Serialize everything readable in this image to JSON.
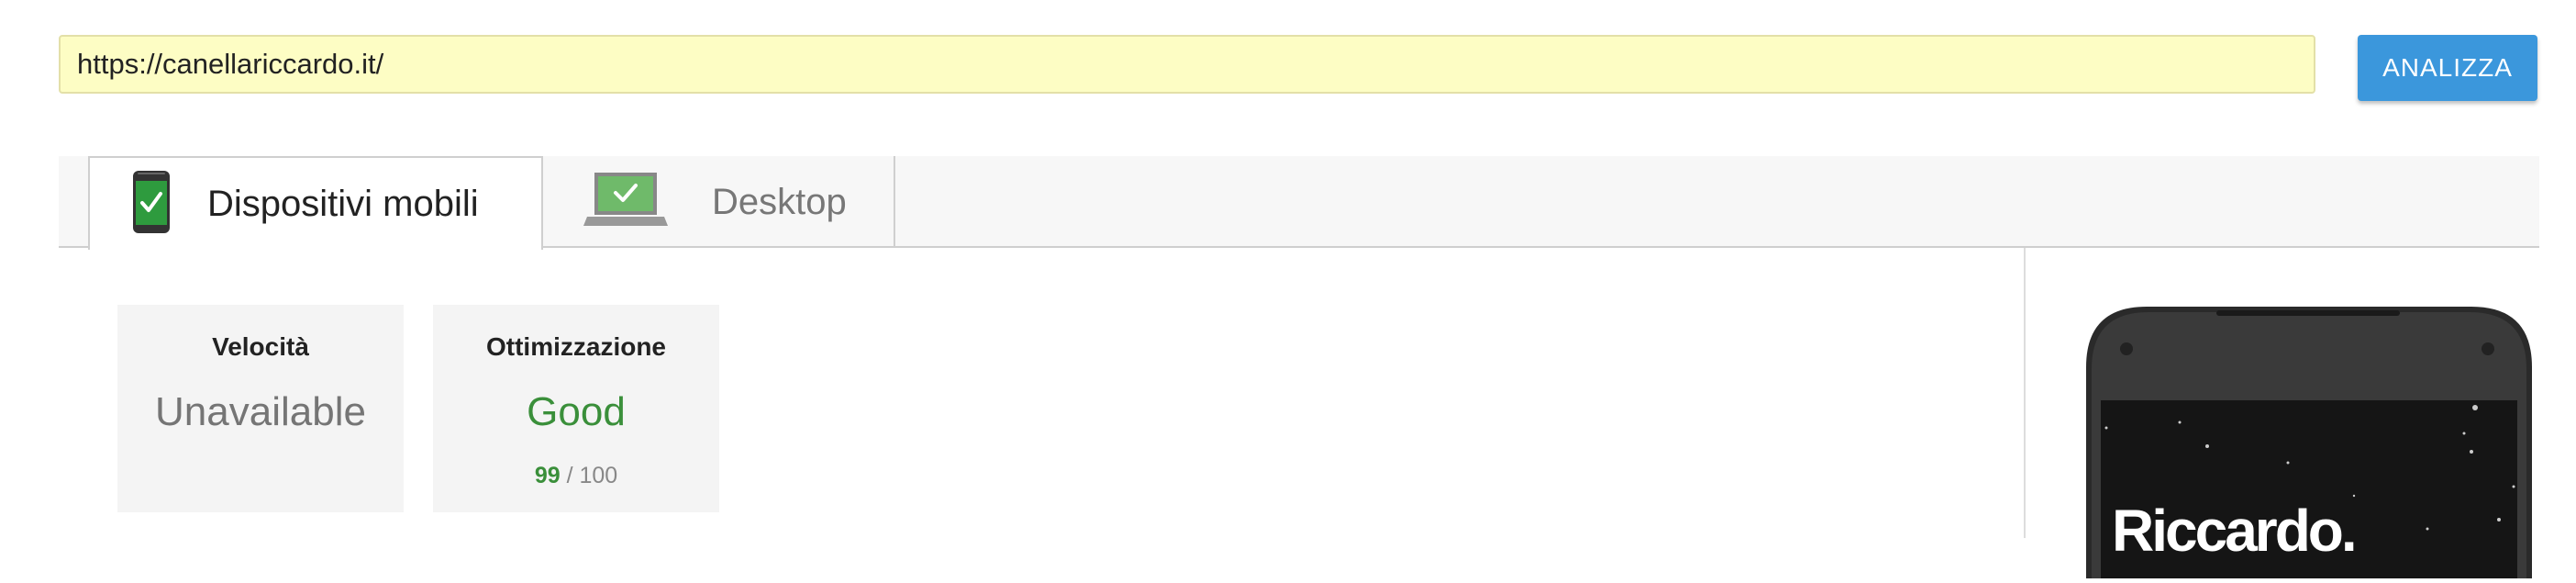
{
  "url_bar": {
    "value": "https://canellariccardo.it/"
  },
  "analyze_button": {
    "label": "ANALIZZA"
  },
  "tabs": [
    {
      "label": "Dispositivi mobili",
      "icon": "mobile-phone-check-icon",
      "active": true
    },
    {
      "label": "Desktop",
      "icon": "laptop-check-icon",
      "active": false
    }
  ],
  "cards": {
    "speed": {
      "title": "Velocità",
      "value": "Unavailable"
    },
    "optimization": {
      "title": "Ottimizzazione",
      "value": "Good",
      "score": "99",
      "score_max": "/ 100"
    }
  },
  "preview": {
    "heading": "Riccardo."
  },
  "colors": {
    "accent": "#3b97dc",
    "good": "#3a8f3a",
    "url_background": "#fdfdc4"
  }
}
